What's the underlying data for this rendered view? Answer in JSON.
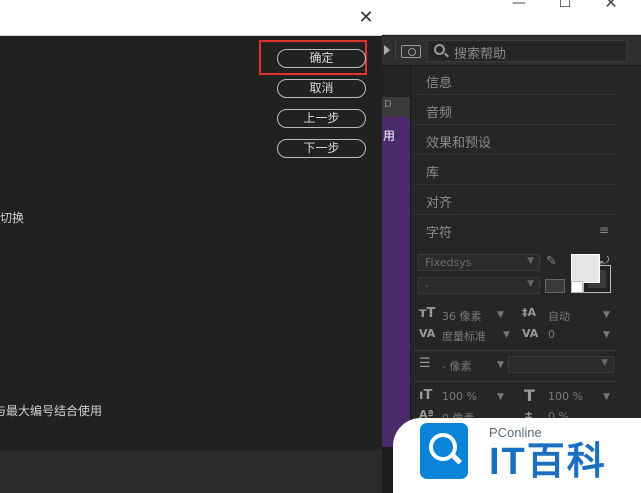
{
  "dialog": {
    "close_glyph": "✕",
    "buttons": {
      "ok": "确定",
      "cancel": "取消",
      "prev": "上一步",
      "next": "下一步"
    },
    "text_fragments": [
      "切换",
      "与最大编号结合使用"
    ],
    "highlight_color": "#e3312d"
  },
  "app": {
    "window_controls": {
      "minimize": "—",
      "maximize": "☐",
      "close": "✕"
    },
    "search": {
      "placeholder": "搜索帮助"
    },
    "mid_tab_label": "D",
    "mid_text": "用",
    "panel_sections": [
      {
        "label": "信息"
      },
      {
        "label": "音频"
      },
      {
        "label": "效果和预设"
      },
      {
        "label": "库"
      },
      {
        "label": "对齐"
      },
      {
        "label": "字符"
      }
    ],
    "character": {
      "font_family": "Fixedsys",
      "font_style": "-",
      "size": "36 像素",
      "leading": "自动",
      "kerning": "度量标准",
      "tracking": "0",
      "stroke_width": "- 像素",
      "vertical_scale": "100 %",
      "horizontal_scale": "100 %",
      "baseline_shift": "0 像素",
      "tsume": "0 %"
    },
    "colors": {
      "accent_purple": "#4a2a6b",
      "panel_bg": "#262626"
    }
  },
  "watermark": {
    "small": "PConline",
    "big": "IT百科",
    "brand_color": "#0a84d8"
  }
}
